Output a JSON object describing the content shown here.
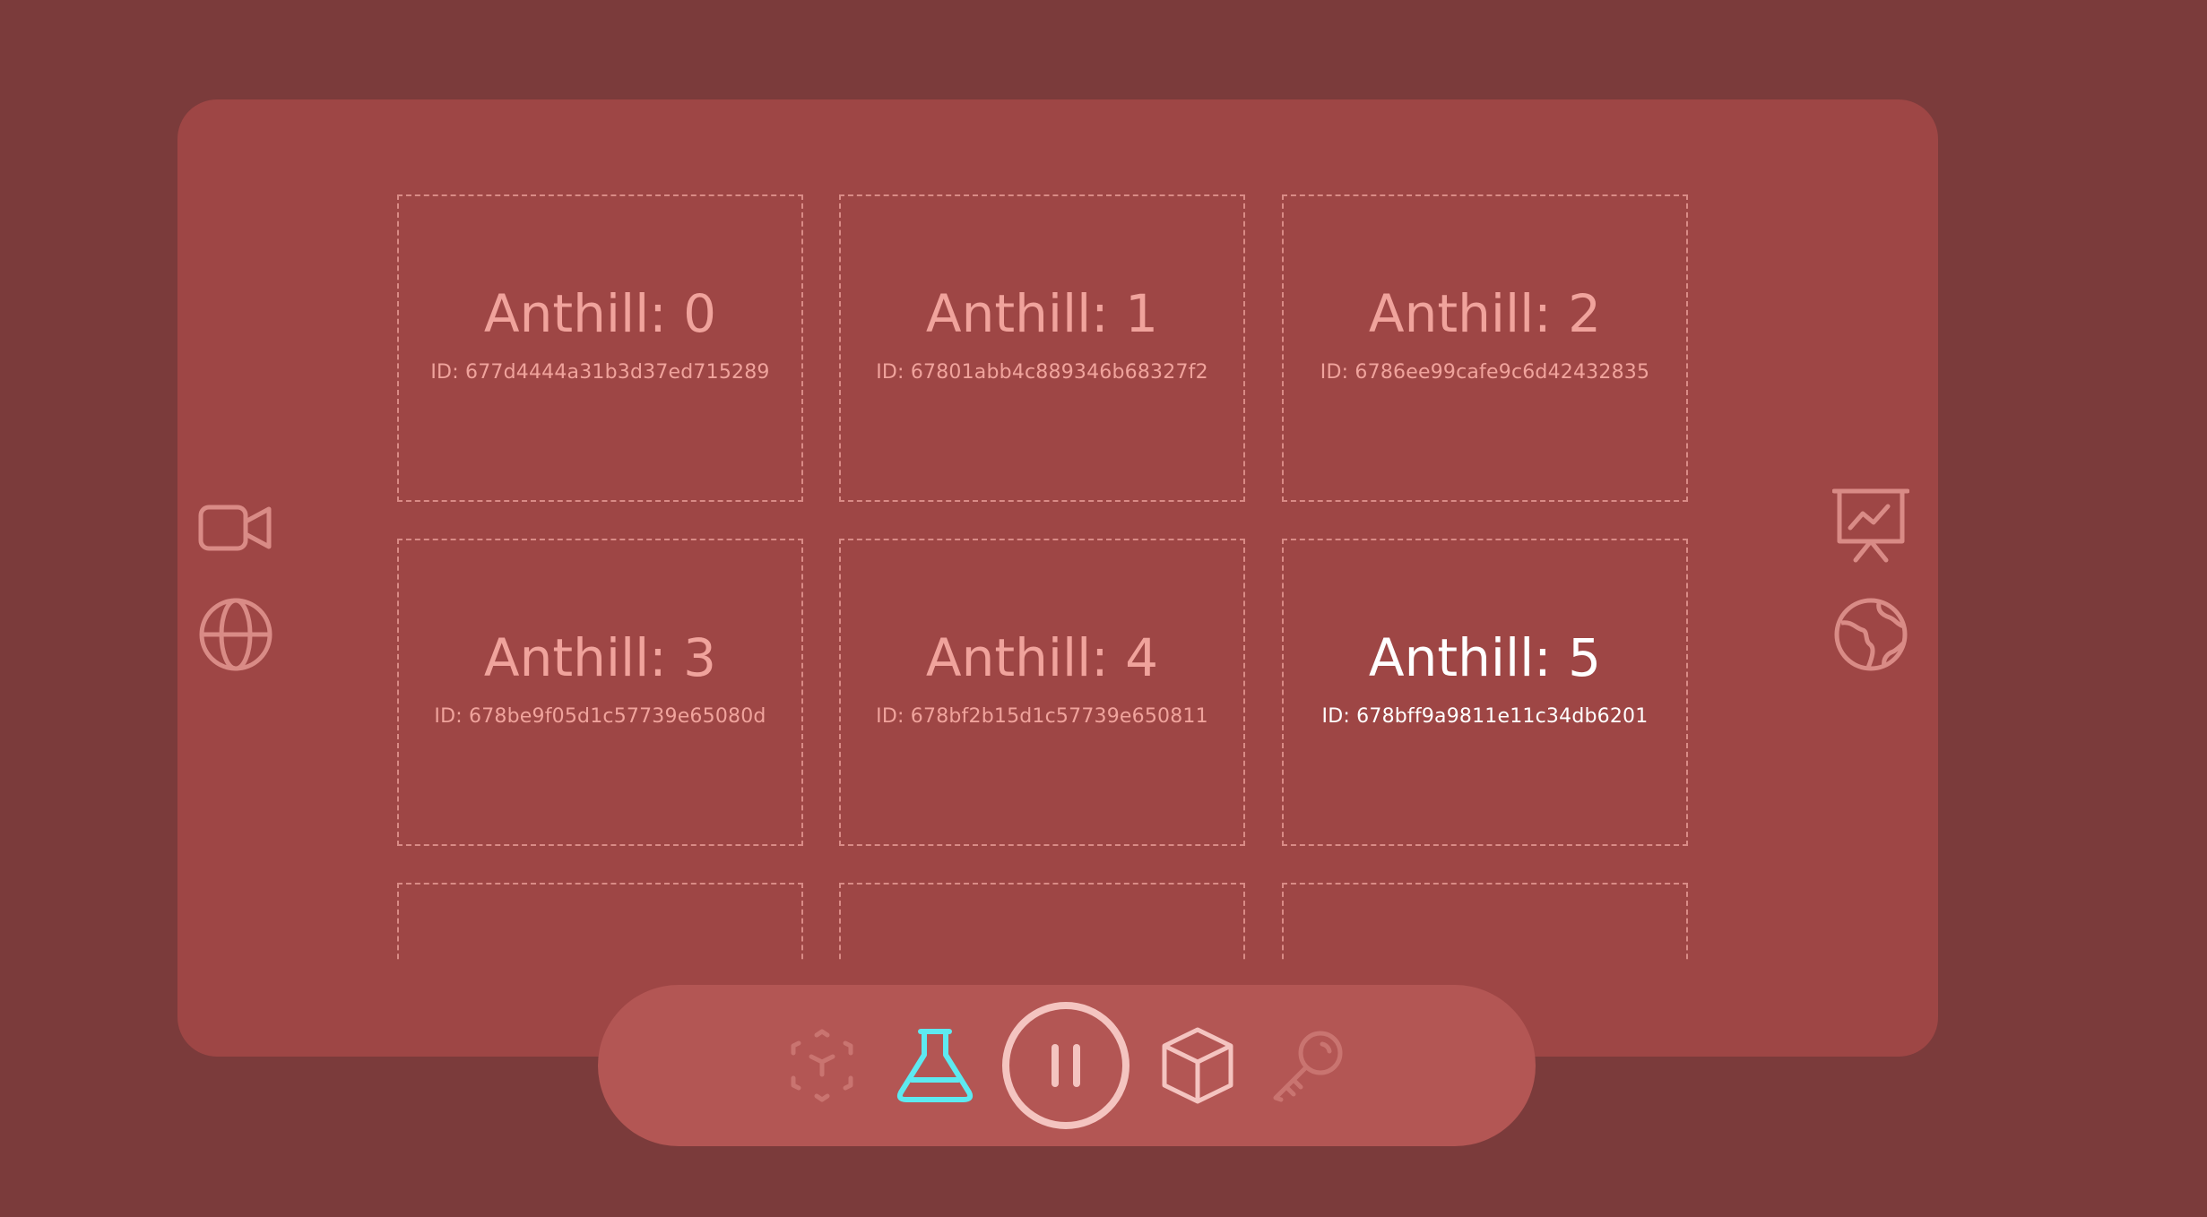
{
  "anthills": [
    {
      "title": "Anthill: 0",
      "id": "ID: 677d4444a31b3d37ed715289"
    },
    {
      "title": "Anthill: 1",
      "id": "ID: 67801abb4c889346b68327f2"
    },
    {
      "title": "Anthill: 2",
      "id": "ID: 6786ee99cafe9c6d42432835"
    },
    {
      "title": "Anthill: 3",
      "id": "ID: 678be9f05d1c57739e65080d"
    },
    {
      "title": "Anthill: 4",
      "id": "ID: 678bf2b15d1c57739e650811"
    },
    {
      "title": "Anthill: 5",
      "id": "ID: 678bff9a9811e11c34db6201"
    }
  ],
  "active_index": 5,
  "icons": {
    "left": [
      "video-camera-icon",
      "globe-icon"
    ],
    "right": [
      "presentation-chart-icon",
      "earth-icon"
    ],
    "dock": [
      "ar-cube-icon",
      "flask-icon",
      "pause-icon",
      "cube-icon",
      "key-icon"
    ]
  },
  "colors": {
    "background": "#7b3b3b",
    "panel": "#9e4645",
    "dock": "#b35654",
    "text": "#f0a39c",
    "active_text": "#ffffff",
    "accent": "#5de9f0"
  }
}
